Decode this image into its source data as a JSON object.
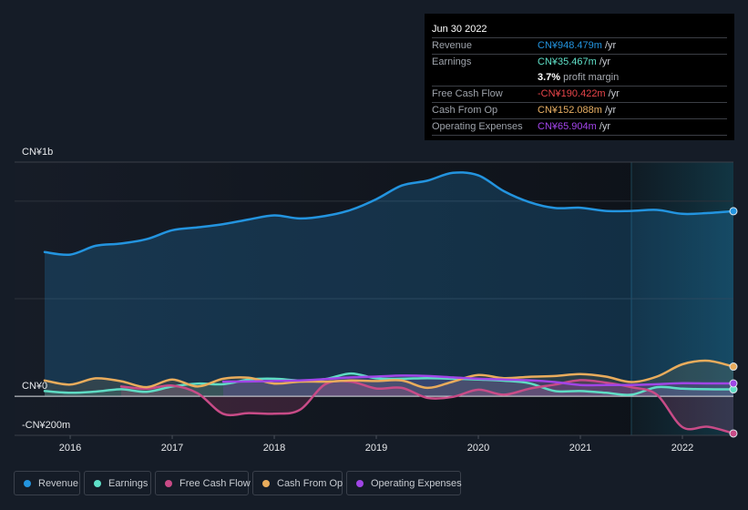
{
  "tooltip": {
    "date": "Jun 30 2022",
    "rows": [
      {
        "label": "Revenue",
        "value": "CN¥948.479m",
        "unit": "/yr",
        "color": "#2394df"
      },
      {
        "label": "Earnings",
        "value": "CN¥35.467m",
        "unit": "/yr",
        "color": "#5fe0c8"
      },
      {
        "label": "",
        "value": "3.7%",
        "unit": "profit margin",
        "color": "#ffffff"
      },
      {
        "label": "Free Cash Flow",
        "value": "-CN¥190.422m",
        "unit": "/yr",
        "color": "#e8454a"
      },
      {
        "label": "Cash From Op",
        "value": "CN¥152.088m",
        "unit": "/yr",
        "color": "#e9b064"
      },
      {
        "label": "Operating Expenses",
        "value": "CN¥65.904m",
        "unit": "/yr",
        "color": "#a445ec"
      }
    ]
  },
  "legend": {
    "items": [
      {
        "label": "Revenue",
        "color": "#2394df"
      },
      {
        "label": "Earnings",
        "color": "#5fe0c8"
      },
      {
        "label": "Free Cash Flow",
        "color": "#c94a86"
      },
      {
        "label": "Cash From Op",
        "color": "#e9ac5c"
      },
      {
        "label": "Operating Expenses",
        "color": "#a045e6"
      }
    ]
  },
  "chart_data": {
    "type": "area",
    "title": "",
    "xlabel": "",
    "ylabel": "",
    "unit": "CN¥m",
    "xlim": [
      2015.455,
      2022.5
    ],
    "ylim": [
      -200,
      1200
    ],
    "grid": true,
    "gridlines": [
      1200,
      1000,
      500
    ],
    "zero_line": 0,
    "legend_position": "bottom-left",
    "highlight_range": [
      2021.5,
      2022.5
    ],
    "x_ticks": [
      {
        "value": 2016,
        "label": "2016"
      },
      {
        "value": 2017,
        "label": "2017"
      },
      {
        "value": 2018,
        "label": "2018"
      },
      {
        "value": 2019,
        "label": "2019"
      },
      {
        "value": 2020,
        "label": "2020"
      },
      {
        "value": 2021,
        "label": "2021"
      },
      {
        "value": 2022,
        "label": "2022"
      }
    ],
    "y_labels": [
      {
        "value": 1200,
        "label": "CN¥1b"
      },
      {
        "value": 0,
        "label": "CN¥0"
      },
      {
        "value": -200,
        "label": "-CN¥200m"
      }
    ],
    "x": [
      "2015-09-30",
      "2015-12-31",
      "2016-03-31",
      "2016-06-30",
      "2016-09-30",
      "2016-12-31",
      "2017-03-31",
      "2017-06-30",
      "2017-09-30",
      "2017-12-31",
      "2018-03-31",
      "2018-06-30",
      "2018-09-30",
      "2018-12-31",
      "2019-03-31",
      "2019-06-30",
      "2019-09-30",
      "2019-12-31",
      "2020-03-31",
      "2020-06-30",
      "2020-09-30",
      "2020-12-31",
      "2021-03-31",
      "2021-06-30",
      "2021-09-30",
      "2021-12-31",
      "2022-03-31",
      "2022-06-30"
    ],
    "series": [
      {
        "name": "Revenue",
        "key": "revenue",
        "color": "#2394df",
        "fill_opacity": 0.22,
        "values": [
          739,
          726,
          771,
          783,
          805,
          851,
          866,
          882,
          906,
          927,
          911,
          924,
          955,
          1010,
          1080,
          1105,
          1145,
          1132,
          1051,
          995,
          965,
          966,
          950,
          950,
          955,
          935,
          939,
          948.479
        ]
      },
      {
        "name": "Earnings",
        "key": "earnings",
        "color": "#5fdcc4",
        "fill_opacity": 0.12,
        "values": [
          27,
          18,
          24,
          36,
          23,
          50,
          65,
          62,
          86,
          90,
          81,
          88,
          117,
          92,
          90,
          93,
          90,
          86,
          80,
          67,
          27,
          27,
          18,
          8,
          47,
          39,
          36,
          35.467
        ]
      },
      {
        "name": "Free Cash Flow",
        "key": "free-cash-flow",
        "color": "#c84b87",
        "fill_opacity": 0.2,
        "values": [
          null,
          null,
          null,
          50,
          39,
          55,
          15,
          -90,
          -86,
          -89,
          -70,
          62,
          75,
          40,
          43,
          -8,
          -3,
          34,
          8,
          39,
          60,
          83,
          70,
          47,
          8,
          -158,
          -156,
          -190.422
        ]
      },
      {
        "name": "Cash From Op",
        "key": "cash-from-op",
        "color": "#e9ac5c",
        "fill_opacity": 0.12,
        "values": [
          81,
          60,
          92,
          77,
          47,
          86,
          50,
          90,
          95,
          65,
          75,
          75,
          81,
          78,
          81,
          43,
          75,
          109,
          93,
          100,
          104,
          114,
          101,
          73,
          101,
          164,
          182,
          152.088
        ]
      },
      {
        "name": "Operating Expenses",
        "key": "operating-expenses",
        "color": "#a045e6",
        "fill_opacity": 0.18,
        "values": [
          null,
          null,
          null,
          null,
          null,
          null,
          null,
          75,
          76,
          78,
          81,
          88,
          97,
          101,
          106,
          104,
          97,
          90,
          86,
          82,
          73,
          58,
          58,
          58,
          62,
          67,
          66,
          65.904
        ]
      }
    ]
  }
}
